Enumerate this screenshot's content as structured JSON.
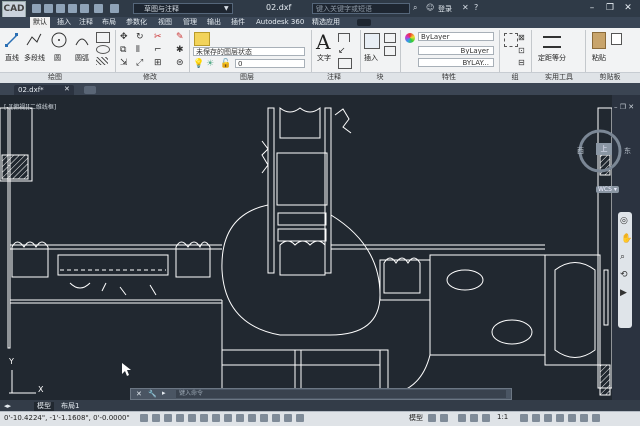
{
  "titlebar": {
    "logo": "CAD",
    "workspace": "草图与注释",
    "doc_title": "02.dxf",
    "search_placeholder": "键入关键字或短语",
    "login": "登录"
  },
  "tabs": [
    {
      "label": "默认",
      "active": true
    },
    {
      "label": "插入"
    },
    {
      "label": "注释"
    },
    {
      "label": "布局"
    },
    {
      "label": "参数化"
    },
    {
      "label": "视图"
    },
    {
      "label": "管理"
    },
    {
      "label": "输出"
    },
    {
      "label": "插件"
    },
    {
      "label": "Autodesk 360"
    },
    {
      "label": "精选应用"
    }
  ],
  "ribbon": {
    "draw": {
      "line": "直线",
      "polyline": "多段线",
      "circle": "圆",
      "arc": "圆弧",
      "panel": "绘图"
    },
    "modify": {
      "panel": "修改"
    },
    "layers": {
      "state": "未保存的图层状态",
      "current": "0",
      "panel": "图层"
    },
    "annotation": {
      "text": "文字",
      "panel": "注释"
    },
    "block": {
      "insert": "插入",
      "panel": "块"
    },
    "properties": {
      "color": "ByLayer",
      "linetype": "ByLayer",
      "lineweight": "BYLAY...",
      "panel": "特性"
    },
    "groups": {
      "panel": "组"
    },
    "utilities": {
      "measure": "定距等分",
      "panel": "实用工具"
    },
    "clipboard": {
      "paste": "粘贴",
      "panel": "剪贴板"
    }
  },
  "doc_tab": "02.dxf*",
  "viewport": {
    "label": "[-][俯视][二维线框]",
    "cube_top": "上",
    "cube_west": "西",
    "cube_east": "东",
    "cube_south": "WCS ▾",
    "axis_y": "Y",
    "axis_x": "X"
  },
  "command": {
    "placeholder": "键入命令"
  },
  "layout_tabs": [
    {
      "label": "模型",
      "active": true
    },
    {
      "label": "布局1"
    }
  ],
  "status": {
    "coords": "0'-10.4224\", -1'-1.1608\", 0'-0.0000\"",
    "model": "模型",
    "scale": "1:1"
  },
  "colors": {
    "background": "#212830",
    "linework": "#ffffff",
    "titlebar": "#2f3a47"
  }
}
